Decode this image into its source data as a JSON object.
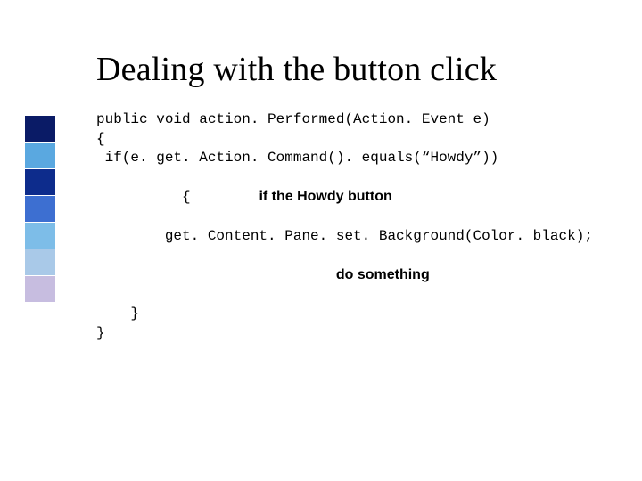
{
  "title": "Dealing with the button click",
  "sidebar_colors": [
    "#0a1b66",
    "#5aa8e0",
    "#0d2c8c",
    "#3d6fd1",
    "#7dbde8",
    "#a9c9e8",
    "#c7bde0"
  ],
  "code": {
    "l1": "public void action. Performed(Action. Event e)",
    "l2": "{",
    "l3": " if(e. get. Action. Command(). equals(“Howdy”))",
    "l4_brace": "    {",
    "l4_comment": "if the Howdy button",
    "l5": "        get. Content. Pane. set. Background(Color. black);",
    "l6_comment": "do something",
    "l7": "    }",
    "l8": "}"
  }
}
